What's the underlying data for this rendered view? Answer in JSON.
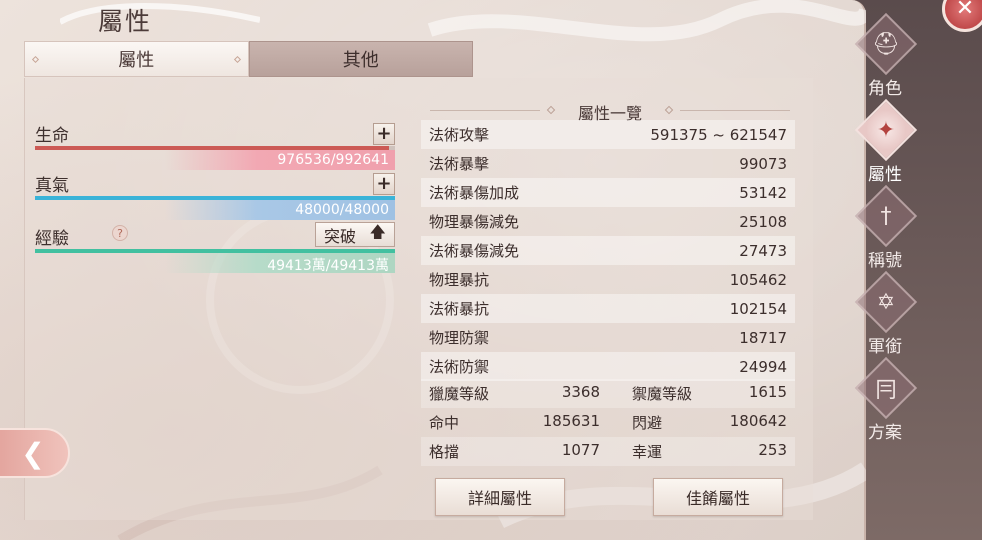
{
  "header": {
    "title": "屬性"
  },
  "tabs": [
    {
      "label": "屬性",
      "active": true
    },
    {
      "label": "其他",
      "active": false
    }
  ],
  "vitals": {
    "hp": {
      "label": "生命",
      "current": 976536,
      "max": 992641,
      "text": "976536/992641",
      "fraction": 0.984,
      "color": "#cc5a55"
    },
    "mp": {
      "label": "真氣",
      "current": 48000,
      "max": 48000,
      "text": "48000/48000",
      "fraction": 1.0,
      "color": "#3ab3d8"
    },
    "xp": {
      "label": "經驗",
      "text": "49413萬/49413萬",
      "fraction": 1.0,
      "color": "#42c0a0",
      "help_icon": "question-icon",
      "breakthrough_label": "突破",
      "breakthrough_icon": "up-arrow-icon"
    }
  },
  "plus_glyph": "+",
  "attributes": {
    "section_title": "屬性一覽",
    "rows": [
      {
        "name": "法術攻擊",
        "value": "591375 ~ 621547"
      },
      {
        "name": "法術暴擊",
        "value": "99073"
      },
      {
        "name": "法術暴傷加成",
        "value": "53142"
      },
      {
        "name": "物理暴傷減免",
        "value": "25108"
      },
      {
        "name": "法術暴傷減免",
        "value": "27473"
      },
      {
        "name": "物理暴抗",
        "value": "105462"
      },
      {
        "name": "法術暴抗",
        "value": "102154"
      },
      {
        "name": "物理防禦",
        "value": "18717"
      },
      {
        "name": "法術防禦",
        "value": "24994"
      }
    ],
    "grid": [
      [
        {
          "name": "獵魔等級",
          "value": "3368"
        },
        {
          "name": "禦魔等級",
          "value": "1615"
        }
      ],
      [
        {
          "name": "命中",
          "value": "185631"
        },
        {
          "name": "閃避",
          "value": "180642"
        }
      ],
      [
        {
          "name": "格擋",
          "value": "1077"
        },
        {
          "name": "幸運",
          "value": "253"
        }
      ]
    ]
  },
  "buttons": {
    "detail": "詳細屬性",
    "best": "佳餚屬性"
  },
  "side_nav": [
    {
      "label": "角色",
      "icon": "helmet-icon",
      "glyph": "⛑",
      "active": false
    },
    {
      "label": "屬性",
      "icon": "attribute-emblem-icon",
      "glyph": "✦",
      "active": true
    },
    {
      "label": "稱號",
      "icon": "title-sword-icon",
      "glyph": "†",
      "active": false
    },
    {
      "label": "軍銜",
      "icon": "rank-star-icon",
      "glyph": "✡",
      "active": false
    },
    {
      "label": "方案",
      "icon": "scheme-icon",
      "glyph": "冃",
      "active": false
    }
  ],
  "close_glyph": "✕",
  "back_glyph": "❮"
}
